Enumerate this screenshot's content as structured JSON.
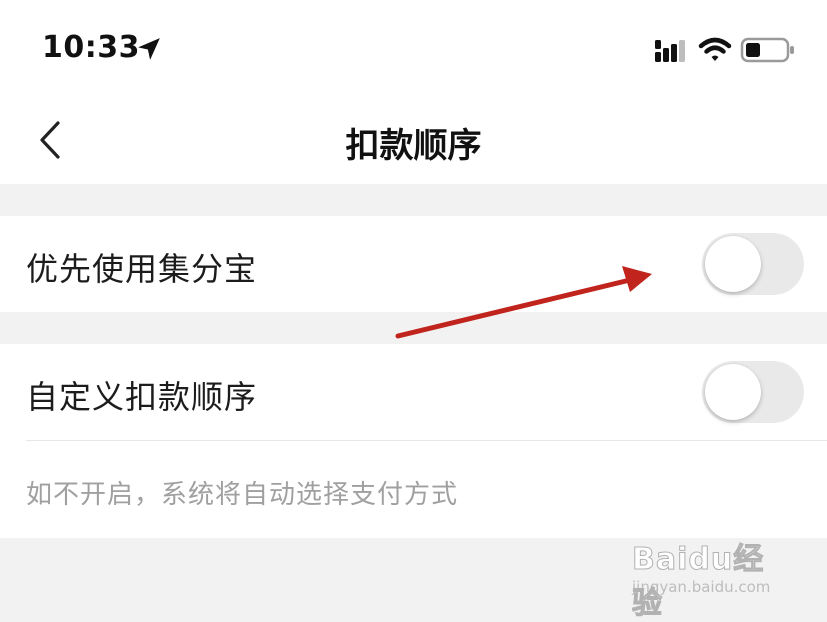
{
  "status_bar": {
    "time": "10:33"
  },
  "nav": {
    "title": "扣款顺序"
  },
  "settings": [
    {
      "label": "优先使用集分宝",
      "enabled": false
    },
    {
      "label": "自定义扣款顺序",
      "enabled": false,
      "hint": "如不开启，系统将自动选择支付方式"
    }
  ],
  "annotation": {
    "arrow_color": "#c0241c"
  },
  "watermark": {
    "logo": "Baidu经验",
    "url": "jingyan.baidu.com"
  },
  "colors": {
    "background": "#f2f2f2",
    "card": "#ffffff",
    "toggle_off": "#e9e9ea",
    "hint_text": "#a0a0a0"
  },
  "icons": [
    "location-arrow-icon",
    "cellular-signal-icon",
    "wifi-icon",
    "battery-icon",
    "back-chevron-icon"
  ]
}
